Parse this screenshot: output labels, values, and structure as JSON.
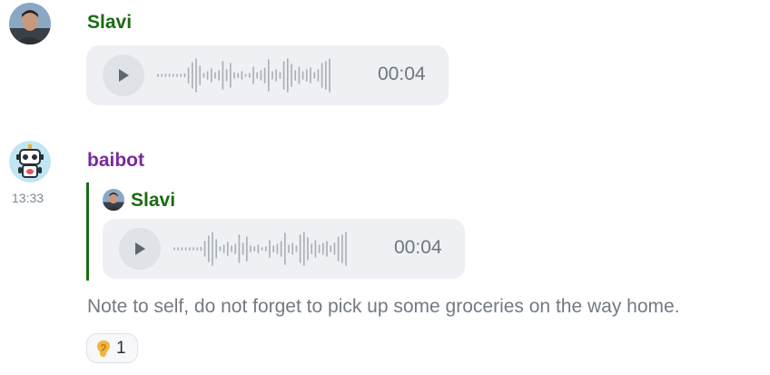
{
  "colors": {
    "slavi_name": "#1b6b12",
    "baibot_name": "#7a2a9c",
    "voice_bg": "#eef0f3",
    "quote_bar": "#1b6b12",
    "waveform": "#a8aeb6"
  },
  "messages": [
    {
      "sender": "Slavi",
      "avatar_icon": "user-photo-avatar",
      "voice": {
        "duration": "00:04",
        "play_icon": "play-icon"
      }
    },
    {
      "sender": "baibot",
      "avatar_icon": "robot-avatar",
      "timestamp": "13:33",
      "quote": {
        "sender": "Slavi",
        "avatar_icon": "user-photo-avatar",
        "voice": {
          "duration": "00:04",
          "play_icon": "play-icon"
        }
      },
      "text": "Note to self, do not forget to pick up some groceries on the way home.",
      "reaction": {
        "icon": "ear-emoji",
        "count": "1"
      }
    }
  ]
}
